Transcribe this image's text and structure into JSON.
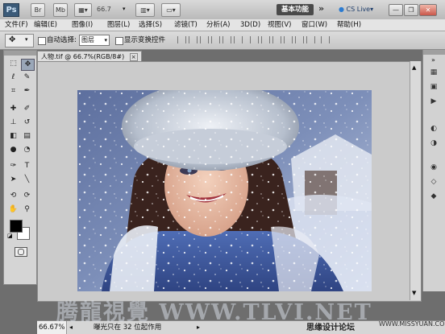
{
  "appbar": {
    "logo": "Ps",
    "mb_label": "Mb",
    "zoom": "66.7",
    "workspace": "基本功能",
    "more": "»",
    "cslive": "CS Live▾"
  },
  "menu": [
    "文件(F)",
    "编辑(E)",
    "图像(I)",
    "图层(L)",
    "选择(S)",
    "滤镜(T)",
    "分析(A)",
    "3D(D)",
    "视图(V)",
    "窗口(W)",
    "帮助(H)"
  ],
  "options": {
    "auto_select_label": "自动选择:",
    "auto_select_value": "图层",
    "show_transform_label": "显示变换控件"
  },
  "document": {
    "tab_title": "人物.tif @ 66.7%(RGB/8#)",
    "tab_close": "×"
  },
  "status": {
    "zoom": "66.67%",
    "info": "曝光只在 32 位起作用"
  },
  "watermarks": {
    "tlv": "腾龍視覺 WWW.TLVI.NET",
    "site_cn": "思缘设计论坛",
    "site_url": "WWW.MISSYUAN.COM"
  },
  "colors": {
    "foreground": "#000000",
    "background": "#ffffff"
  }
}
